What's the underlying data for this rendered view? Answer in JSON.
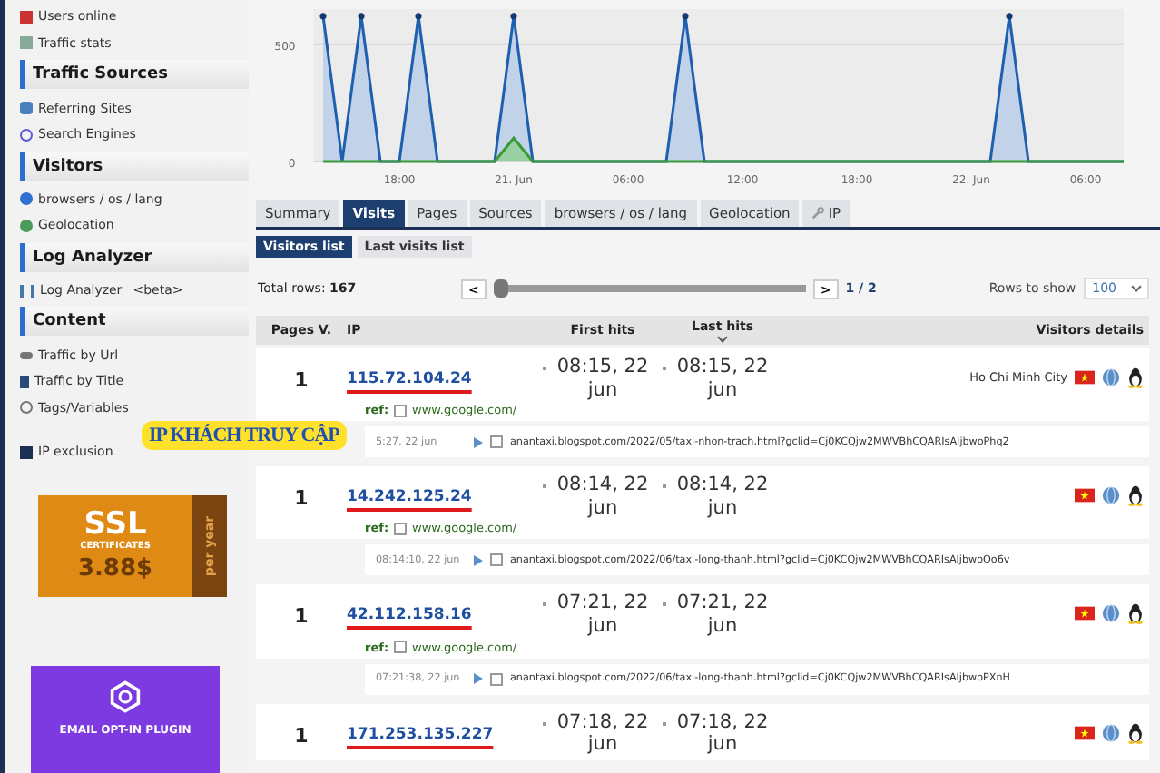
{
  "sidebar": {
    "items": [
      {
        "kind": "item",
        "label": "Users online"
      },
      {
        "kind": "item",
        "label": "Traffic stats"
      },
      {
        "kind": "header",
        "label": "Traffic Sources"
      },
      {
        "kind": "item",
        "label": "Referring Sites"
      },
      {
        "kind": "item",
        "label": "Search Engines"
      },
      {
        "kind": "header",
        "label": "Visitors"
      },
      {
        "kind": "item",
        "label": "browsers / os / lang"
      },
      {
        "kind": "item",
        "label": "Geolocation"
      },
      {
        "kind": "header",
        "label": "Log Analyzer"
      },
      {
        "kind": "item",
        "label": "Log Analyzer",
        "note": "<beta>"
      },
      {
        "kind": "header",
        "label": "Content"
      },
      {
        "kind": "item",
        "label": "Traffic by Url"
      },
      {
        "kind": "item",
        "label": "Traffic by Title"
      },
      {
        "kind": "item",
        "label": "Tags/Variables"
      },
      {
        "kind": "gap"
      },
      {
        "kind": "item",
        "label": "IP exclusion"
      }
    ],
    "ads": [
      {
        "kind": "ssl",
        "title": "SSL",
        "subtitle": "CERTIFICATES",
        "price": "3.88$",
        "side": "per year"
      },
      {
        "kind": "plugin",
        "title": "EMAIL OPT-IN PLUGIN"
      }
    ]
  },
  "chart": {
    "chart_data": {
      "type": "area",
      "categories": [
        null,
        null,
        null,
        null,
        "18:00",
        null,
        null,
        null,
        null,
        null,
        "21. Jun",
        null,
        null,
        null,
        null,
        null,
        "06:00",
        null,
        null,
        null,
        null,
        null,
        "12:00",
        null,
        null,
        null,
        null,
        null,
        "18:00",
        null,
        null,
        null,
        null,
        null,
        "22. Jun",
        null,
        null,
        null,
        null,
        null,
        "06:00",
        null,
        null
      ],
      "series": [
        {
          "color": "#1f5fb0",
          "values": [
            620,
            0,
            620,
            0,
            0,
            620,
            0,
            0,
            0,
            0,
            620,
            0,
            0,
            0,
            0,
            0,
            0,
            0,
            0,
            620,
            0,
            0,
            0,
            0,
            0,
            0,
            0,
            0,
            0,
            0,
            0,
            0,
            0,
            0,
            0,
            0,
            620,
            0,
            0,
            0,
            0,
            0,
            0
          ]
        },
        {
          "color": "#3a9a3a",
          "values": [
            0,
            0,
            0,
            0,
            0,
            0,
            0,
            0,
            0,
            0,
            100,
            0,
            0,
            0,
            0,
            0,
            0,
            0,
            0,
            0,
            0,
            0,
            0,
            0,
            0,
            0,
            0,
            0,
            0,
            0,
            0,
            0,
            0,
            0,
            0,
            0,
            0,
            0,
            0,
            0,
            0,
            0,
            0
          ]
        }
      ],
      "ylim": [
        0,
        650
      ],
      "yticks": [
        0,
        500
      ]
    }
  },
  "tabs": [
    {
      "label": "Summary",
      "selected": false
    },
    {
      "label": "Visits",
      "selected": true
    },
    {
      "label": "Pages",
      "selected": false
    },
    {
      "label": "Sources",
      "selected": false
    },
    {
      "label": "browsers / os / lang",
      "selected": false
    },
    {
      "label": "Geolocation",
      "selected": false
    },
    {
      "label": "IP",
      "selected": false,
      "kind": "tool"
    }
  ],
  "subtabs": [
    {
      "label": "Visitors list",
      "selected": true
    },
    {
      "label": "Last visits list",
      "selected": false
    }
  ],
  "pager": {
    "total": "Total rows: **167**",
    "level": 0,
    "prev": "<",
    "next": ">",
    "page": "1 / 2",
    "rows_label": "Rows to show",
    "rows_value": "100"
  },
  "table": {
    "columns": [
      "Pages V.",
      "IP",
      "First hits",
      "Last hits",
      "Visitors details"
    ],
    "rows": [
      {
        "pages": "1",
        "ip": "115.72.104.24",
        "first": "08:15, 22 jun",
        "last": "08:15, 22 jun",
        "city": "Ho Chi Minh City",
        "ref_label": "ref:",
        "ref": "www.google.com/",
        "detail_time": "5:27, 22 jun",
        "detail_url": "anantaxi.blogspot.com/2022/05/taxi-nhon-trach.html?gclid=Cj0KCQjw2MWVBhCQARIsAIjbwoPhq2"
      },
      {
        "pages": "1",
        "ip": "14.242.125.24",
        "first": "08:14, 22 jun",
        "last": "08:14, 22 jun",
        "ref_label": "ref:",
        "ref": "www.google.com/",
        "detail_time": "08:14:10, 22 jun",
        "detail_url": "anantaxi.blogspot.com/2022/06/taxi-long-thanh.html?gclid=Cj0KCQjw2MWVBhCQARIsAIjbwoOo6v"
      },
      {
        "pages": "1",
        "ip": "42.112.158.16",
        "first": "07:21, 22 jun",
        "last": "07:21, 22 jun",
        "ref_label": "ref:",
        "ref": "www.google.com/",
        "detail_time": "07:21:38, 22 jun",
        "detail_url": "anantaxi.blogspot.com/2022/06/taxi-long-thanh.html?gclid=Cj0KCQjw2MWVBhCQARIsAIjbwoPXnH"
      },
      {
        "pages": "1",
        "ip": "171.253.135.227",
        "first": "07:18, 22 jun",
        "last": "07:18, 22 jun"
      }
    ]
  },
  "annotation": {
    "text": "IP KHÁCH TRUY CẬP"
  }
}
